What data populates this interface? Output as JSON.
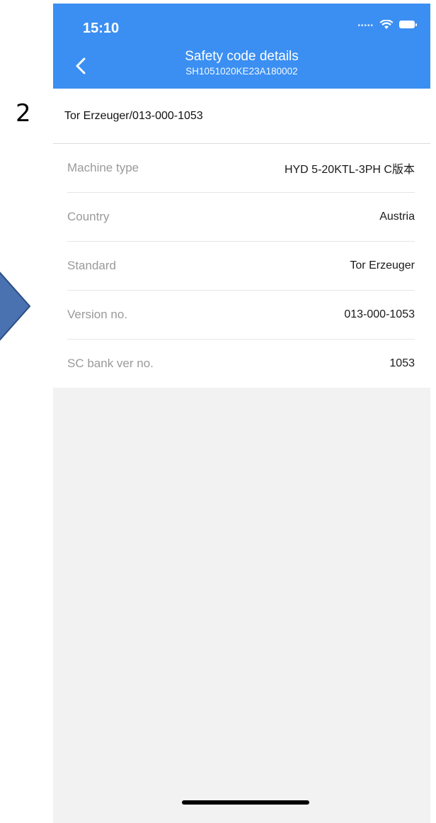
{
  "annotation": {
    "step_number": "2"
  },
  "status_bar": {
    "time": "15:10"
  },
  "header": {
    "title": "Safety code details",
    "subtitle": "SH1051020KE23A180002"
  },
  "section": {
    "heading": "Tor Erzeuger/013-000-1053"
  },
  "details": [
    {
      "label": "Machine type",
      "value": "HYD 5-20KTL-3PH C版本"
    },
    {
      "label": "Country",
      "value": "Austria"
    },
    {
      "label": "Standard",
      "value": "Tor Erzeuger"
    },
    {
      "label": "Version no.",
      "value": "013-000-1053"
    },
    {
      "label": "SC bank ver no.",
      "value": "1053"
    }
  ],
  "colors": {
    "header_bg": "#3b8ff2",
    "annotation_arrow": "#4a72b0"
  }
}
